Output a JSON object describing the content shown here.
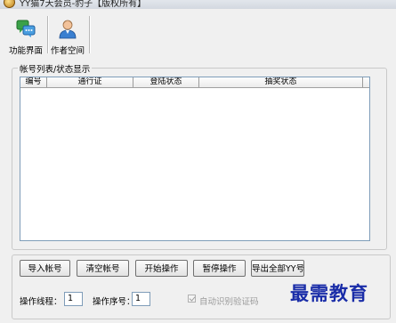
{
  "window": {
    "title": "YY猫7天会员-豹子【版权所有】"
  },
  "toolbar": {
    "items": [
      {
        "label": "功能界面",
        "icon": "chat-bubbles-icon"
      },
      {
        "label": "作者空间",
        "icon": "user-icon"
      }
    ]
  },
  "account_list": {
    "group_title": "帐号列表/状态显示",
    "columns": [
      "编号",
      "通行证",
      "登陆状态",
      "抽奖状态"
    ],
    "rows": []
  },
  "actions": {
    "import_label": "导入帐号",
    "clear_label": "清空帐号",
    "start_label": "开始操作",
    "pause_label": "暂停操作",
    "export_label": "导出全部YY号"
  },
  "settings": {
    "threads_label": "操作线程：",
    "threads_value": "1",
    "serial_label": "操作序号：",
    "serial_value": "1",
    "auto_captcha_label": "自动识别验证码",
    "auto_captcha_checked": true,
    "auto_captcha_enabled": false
  },
  "watermark": {
    "text": "最需教育"
  },
  "colors": {
    "watermark": "#1a2da8",
    "list_border": "#7f9db9",
    "background": "#f0f0f0"
  }
}
